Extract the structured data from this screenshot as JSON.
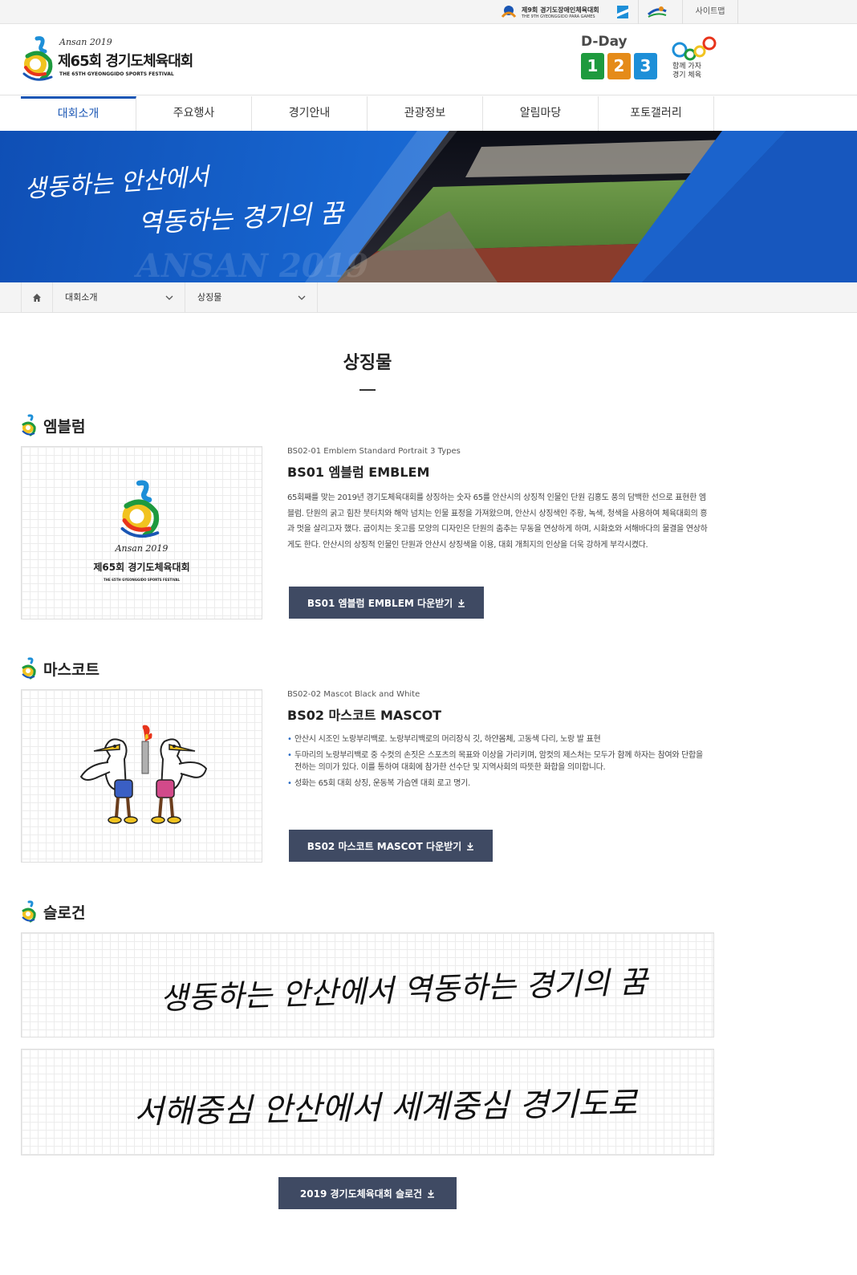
{
  "utility": {
    "para_games_label": "제9회 경기도장애인체육대회",
    "para_games_sub": "THE 9TH GYEONGGIDO PARA GAMES",
    "sitemap_label": "사이트맵"
  },
  "header": {
    "logo_year": "Ansan 2019",
    "logo_title": "제65회 경기도체육대회",
    "logo_sub": "THE 65TH GYEONGGIDO SPORTS FESTIVAL",
    "dday_label": "D-Day",
    "dday_digits": [
      "1",
      "2",
      "3"
    ],
    "go_text_1": "함께 가자",
    "go_text_2": "경기 체육"
  },
  "nav": {
    "items": [
      {
        "label": "대회소개",
        "active": true
      },
      {
        "label": "주요행사",
        "active": false
      },
      {
        "label": "경기안내",
        "active": false
      },
      {
        "label": "관광정보",
        "active": false
      },
      {
        "label": "알림마당",
        "active": false
      },
      {
        "label": "포토갤러리",
        "active": false
      }
    ]
  },
  "banner": {
    "script_line1": "생동하는 안산에서",
    "script_line2": "역동하는 경기의 꿈",
    "watermark": "ANSAN 2019"
  },
  "breadcrumb": {
    "level1": "대회소개",
    "level2": "상징물"
  },
  "page": {
    "title": "상징물"
  },
  "emblem": {
    "section_title": "엠블럼",
    "code": "BS02-01 Emblem Standard Portrait 3 Types",
    "title": "BS01 엠블럼 EMBLEM",
    "description": "65회째를 맞는 2019년 경기도체육대회를 상징하는 숫자 65를 안산시의 상징적 인물인 단원 김홍도 풍의 담백한 선으로 표현한 엠블럼. 단원의 굵고 힘찬 붓터치와 해악 넘치는 인물 표정을 가져왔으며, 안산시 상징색인 주황, 녹색, 청색을 사용하여 체육대회의 흥과 멋을 살리고자 했다. 굽이치는 옷고름 모양의 디자인은 단원의 춤추는 무동을 연상하게 하며, 시화호와 서해바다의 물결을 연상하게도 한다. 안산시의 상징적 인물인 단원과 안산시 상징색을 이용, 대회 개최지의 인상을 더욱 강하게 부각시켰다.",
    "download_label": "BS01 엠블럼 EMBLEM 다운받기",
    "image_year": "Ansan 2019",
    "image_title": "제65회 경기도체육대회",
    "image_sub": "THE 65TH GYEONGGIDO SPORTS FESTIVAL"
  },
  "mascot": {
    "section_title": "마스코트",
    "code": "BS02-02 Mascot Black and White",
    "title": "BS02 마스코트 MASCOT",
    "bullets": [
      "안산시 시조인 노랑부리백로. 노랑부리백로의 머리장식 깃, 하얀몸체, 고동색 다리, 노랑 발 표현",
      "두마리의 노랑부리백로 중 수컷의 손짓은 스포츠의 목표와 이상을 가리키며, 암컷의 제스처는 모두가 함께 하자는 참여와 단합을 전하는 의미가 있다. 이를 통하여 대회에 참가한 선수단 및 지역사회의 따뜻한 화합을 의미합니다.",
      "성화는 65회 대회 상징, 운동복 가슴엔 대회 로고 명기."
    ],
    "download_label": "BS02 마스코트 MASCOT 다운받기"
  },
  "slogan": {
    "section_title": "슬로건",
    "slogan1": "생동하는 안산에서 역동하는 경기의 꿈",
    "slogan2": "서해중심 안산에서 세계중심 경기도로",
    "download_label": "2019 경기도체육대회 슬로건"
  },
  "colors": {
    "primary_blue": "#1a56b4",
    "button_navy": "#3f4a63",
    "dday_green": "#1e9a3e",
    "dday_orange": "#e58b19",
    "dday_blue": "#1d8fd8"
  }
}
